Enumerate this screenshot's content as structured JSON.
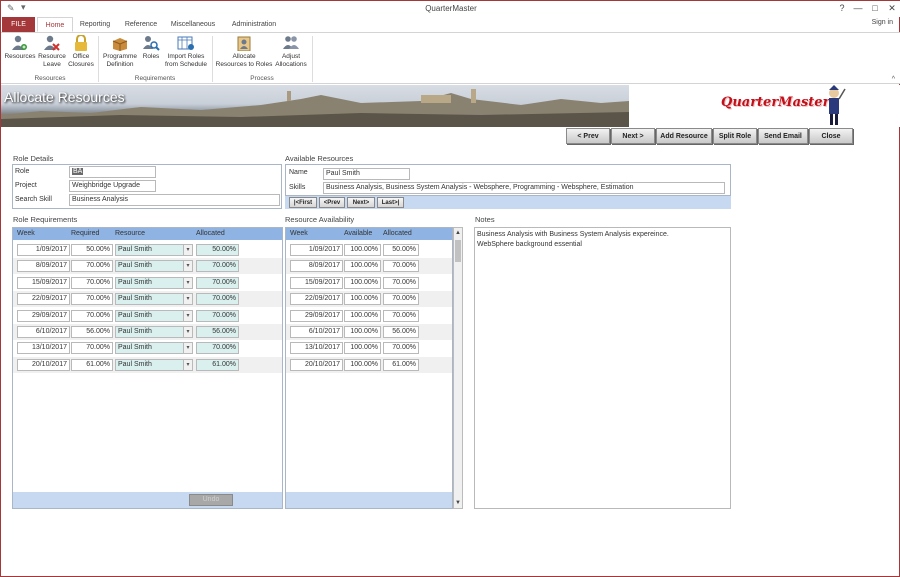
{
  "window": {
    "title": "QuarterMaster",
    "help": "?",
    "minimize": "—",
    "maximize": "□",
    "close": "✕"
  },
  "tabs": [
    {
      "label": "FILE"
    },
    {
      "label": "Home"
    },
    {
      "label": "Reporting"
    },
    {
      "label": "Reference"
    },
    {
      "label": "Miscellaneous"
    },
    {
      "label": "Administration"
    }
  ],
  "signin": "Sign in",
  "ribbon": {
    "resources_group": "Resources",
    "requirements_group": "Requirements",
    "process_group": "Process",
    "buttons": {
      "resources": "Resources",
      "resource_leave_1": "Resource",
      "resource_leave_2": "Leave",
      "office_closures_1": "Office",
      "office_closures_2": "Closures",
      "programme_def_1": "Programme",
      "programme_def_2": "Definition",
      "roles": "Roles",
      "import_roles_1": "Import Roles",
      "import_roles_2": "from Schedule",
      "allocate_1": "Allocate",
      "allocate_2": "Resources to Roles",
      "adjust_1": "Adjust",
      "adjust_2": "Allocations"
    }
  },
  "banner": {
    "heading": "Allocate Resources",
    "logo": "QuarterMaster"
  },
  "nav": {
    "prev": "< Prev",
    "next": "Next >",
    "add": "Add Resource",
    "split": "Split Role",
    "email": "Send Email",
    "close": "Close"
  },
  "role_details": {
    "section": "Role Details",
    "role_label": "Role",
    "role_value": "BA",
    "project_label": "Project",
    "project_value": "Weighbridge Upgrade",
    "search_label": "Search Skill",
    "search_value": "Business Analysis"
  },
  "available": {
    "section": "Available Resources",
    "name_label": "Name",
    "name_value": "Paul Smith",
    "skills_label": "Skills",
    "skills_value": "Business Analysis, Business System Analysis - Websphere, Programming - Websphere, Estimation",
    "first": "|<First",
    "prev": "<Prev",
    "next": "Next>",
    "last": "Last>|"
  },
  "role_req": {
    "section": "Role Requirements",
    "headers": {
      "week": "Week",
      "required": "Required",
      "resource": "Resource",
      "allocated": "Allocated"
    },
    "rows": [
      {
        "week": "1/09/2017",
        "required": "50.00%",
        "resource": "Paul Smith",
        "allocated": "50.00%"
      },
      {
        "week": "8/09/2017",
        "required": "70.00%",
        "resource": "Paul Smith",
        "allocated": "70.00%"
      },
      {
        "week": "15/09/2017",
        "required": "70.00%",
        "resource": "Paul Smith",
        "allocated": "70.00%"
      },
      {
        "week": "22/09/2017",
        "required": "70.00%",
        "resource": "Paul Smith",
        "allocated": "70.00%"
      },
      {
        "week": "29/09/2017",
        "required": "70.00%",
        "resource": "Paul Smith",
        "allocated": "70.00%"
      },
      {
        "week": "6/10/2017",
        "required": "56.00%",
        "resource": "Paul Smith",
        "allocated": "56.00%"
      },
      {
        "week": "13/10/2017",
        "required": "70.00%",
        "resource": "Paul Smith",
        "allocated": "70.00%"
      },
      {
        "week": "20/10/2017",
        "required": "61.00%",
        "resource": "Paul Smith",
        "allocated": "61.00%"
      }
    ],
    "undo": "Undo"
  },
  "res_avail": {
    "section": "Resource Availability",
    "headers": {
      "week": "Week",
      "available": "Available",
      "allocated": "Allocated"
    },
    "rows": [
      {
        "week": "1/09/2017",
        "available": "100.00%",
        "allocated": "50.00%"
      },
      {
        "week": "8/09/2017",
        "available": "100.00%",
        "allocated": "70.00%"
      },
      {
        "week": "15/09/2017",
        "available": "100.00%",
        "allocated": "70.00%"
      },
      {
        "week": "22/09/2017",
        "available": "100.00%",
        "allocated": "70.00%"
      },
      {
        "week": "29/09/2017",
        "available": "100.00%",
        "allocated": "70.00%"
      },
      {
        "week": "6/10/2017",
        "available": "100.00%",
        "allocated": "56.00%"
      },
      {
        "week": "13/10/2017",
        "available": "100.00%",
        "allocated": "70.00%"
      },
      {
        "week": "20/10/2017",
        "available": "100.00%",
        "allocated": "61.00%"
      }
    ]
  },
  "notes": {
    "section": "Notes",
    "line1": "Business Analysis with Business System Analysis expereince.",
    "line2": "WebSphere background essential"
  }
}
